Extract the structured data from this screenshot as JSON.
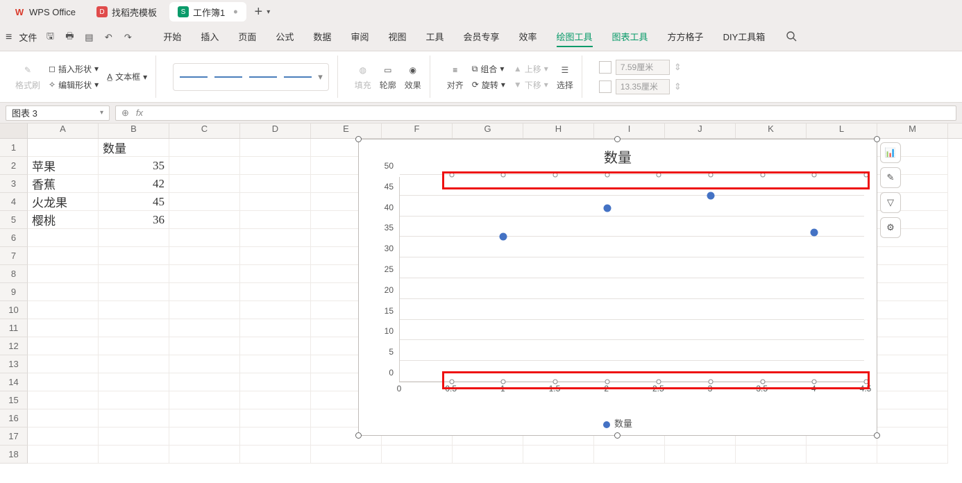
{
  "titlebar": {
    "app_name": "WPS Office",
    "tabs": [
      {
        "icon": "wps",
        "label": "WPS Office"
      },
      {
        "icon": "template",
        "label": "找稻壳模板"
      },
      {
        "icon": "sheet",
        "label": "工作簿1"
      }
    ]
  },
  "menubar": {
    "file_label": "文件",
    "tabs": [
      "开始",
      "插入",
      "页面",
      "公式",
      "数据",
      "审阅",
      "视图",
      "工具",
      "会员专享",
      "效率",
      "绘图工具",
      "图表工具",
      "方方格子",
      "DIY工具箱"
    ],
    "active_index": 10,
    "green_indices": [
      10,
      11
    ]
  },
  "ribbon": {
    "format_painter": "格式刷",
    "insert_shape": "插入形状",
    "text_box": "文本框",
    "edit_shape": "编辑形状",
    "fill": "填充",
    "outline": "轮廓",
    "effect": "效果",
    "align": "对齐",
    "group": "组合",
    "rotate": "旋转",
    "move_up": "上移",
    "move_down": "下移",
    "select": "选择",
    "height_value": "7.59厘米",
    "width_value": "13.35厘米"
  },
  "namebox": {
    "value": "图表 3"
  },
  "formula": {
    "fx": "fx"
  },
  "columns": [
    "A",
    "B",
    "C",
    "D",
    "E",
    "F",
    "G",
    "H",
    "I",
    "J",
    "K",
    "L",
    "M"
  ],
  "rows_count": 18,
  "sheet": {
    "header": {
      "b1": "数量"
    },
    "data": [
      {
        "a": "苹果",
        "b": "35"
      },
      {
        "a": "香蕉",
        "b": "42"
      },
      {
        "a": "火龙果",
        "b": "45"
      },
      {
        "a": "樱桃",
        "b": "36"
      }
    ]
  },
  "chart_data": {
    "type": "scatter",
    "title": "数量",
    "xlabel": "",
    "ylabel": "",
    "xlim": [
      0,
      4.5
    ],
    "ylim": [
      0,
      50
    ],
    "xticks": [
      0,
      0.5,
      1,
      1.5,
      2,
      2.5,
      3,
      3.5,
      4,
      4.5
    ],
    "yticks": [
      0,
      5,
      10,
      15,
      20,
      25,
      30,
      35,
      40,
      45,
      50
    ],
    "series": [
      {
        "name": "数量",
        "x": [
          1,
          2,
          3,
          4
        ],
        "values": [
          35,
          42,
          45,
          36
        ]
      }
    ],
    "legend": "数量"
  },
  "side_tools": [
    "chart-type",
    "edit",
    "filter",
    "settings"
  ]
}
